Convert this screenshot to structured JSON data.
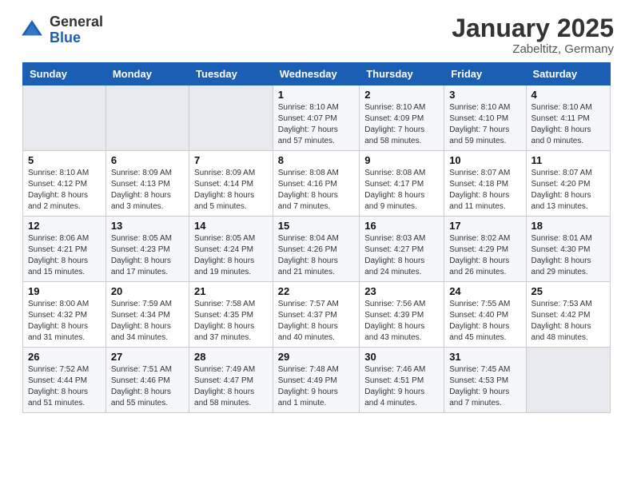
{
  "logo": {
    "general": "General",
    "blue": "Blue"
  },
  "title": "January 2025",
  "location": "Zabeltitz, Germany",
  "days_header": [
    "Sunday",
    "Monday",
    "Tuesday",
    "Wednesday",
    "Thursday",
    "Friday",
    "Saturday"
  ],
  "weeks": [
    [
      {
        "num": "",
        "info": ""
      },
      {
        "num": "",
        "info": ""
      },
      {
        "num": "",
        "info": ""
      },
      {
        "num": "1",
        "info": "Sunrise: 8:10 AM\nSunset: 4:07 PM\nDaylight: 7 hours\nand 57 minutes."
      },
      {
        "num": "2",
        "info": "Sunrise: 8:10 AM\nSunset: 4:09 PM\nDaylight: 7 hours\nand 58 minutes."
      },
      {
        "num": "3",
        "info": "Sunrise: 8:10 AM\nSunset: 4:10 PM\nDaylight: 7 hours\nand 59 minutes."
      },
      {
        "num": "4",
        "info": "Sunrise: 8:10 AM\nSunset: 4:11 PM\nDaylight: 8 hours\nand 0 minutes."
      }
    ],
    [
      {
        "num": "5",
        "info": "Sunrise: 8:10 AM\nSunset: 4:12 PM\nDaylight: 8 hours\nand 2 minutes."
      },
      {
        "num": "6",
        "info": "Sunrise: 8:09 AM\nSunset: 4:13 PM\nDaylight: 8 hours\nand 3 minutes."
      },
      {
        "num": "7",
        "info": "Sunrise: 8:09 AM\nSunset: 4:14 PM\nDaylight: 8 hours\nand 5 minutes."
      },
      {
        "num": "8",
        "info": "Sunrise: 8:08 AM\nSunset: 4:16 PM\nDaylight: 8 hours\nand 7 minutes."
      },
      {
        "num": "9",
        "info": "Sunrise: 8:08 AM\nSunset: 4:17 PM\nDaylight: 8 hours\nand 9 minutes."
      },
      {
        "num": "10",
        "info": "Sunrise: 8:07 AM\nSunset: 4:18 PM\nDaylight: 8 hours\nand 11 minutes."
      },
      {
        "num": "11",
        "info": "Sunrise: 8:07 AM\nSunset: 4:20 PM\nDaylight: 8 hours\nand 13 minutes."
      }
    ],
    [
      {
        "num": "12",
        "info": "Sunrise: 8:06 AM\nSunset: 4:21 PM\nDaylight: 8 hours\nand 15 minutes."
      },
      {
        "num": "13",
        "info": "Sunrise: 8:05 AM\nSunset: 4:23 PM\nDaylight: 8 hours\nand 17 minutes."
      },
      {
        "num": "14",
        "info": "Sunrise: 8:05 AM\nSunset: 4:24 PM\nDaylight: 8 hours\nand 19 minutes."
      },
      {
        "num": "15",
        "info": "Sunrise: 8:04 AM\nSunset: 4:26 PM\nDaylight: 8 hours\nand 21 minutes."
      },
      {
        "num": "16",
        "info": "Sunrise: 8:03 AM\nSunset: 4:27 PM\nDaylight: 8 hours\nand 24 minutes."
      },
      {
        "num": "17",
        "info": "Sunrise: 8:02 AM\nSunset: 4:29 PM\nDaylight: 8 hours\nand 26 minutes."
      },
      {
        "num": "18",
        "info": "Sunrise: 8:01 AM\nSunset: 4:30 PM\nDaylight: 8 hours\nand 29 minutes."
      }
    ],
    [
      {
        "num": "19",
        "info": "Sunrise: 8:00 AM\nSunset: 4:32 PM\nDaylight: 8 hours\nand 31 minutes."
      },
      {
        "num": "20",
        "info": "Sunrise: 7:59 AM\nSunset: 4:34 PM\nDaylight: 8 hours\nand 34 minutes."
      },
      {
        "num": "21",
        "info": "Sunrise: 7:58 AM\nSunset: 4:35 PM\nDaylight: 8 hours\nand 37 minutes."
      },
      {
        "num": "22",
        "info": "Sunrise: 7:57 AM\nSunset: 4:37 PM\nDaylight: 8 hours\nand 40 minutes."
      },
      {
        "num": "23",
        "info": "Sunrise: 7:56 AM\nSunset: 4:39 PM\nDaylight: 8 hours\nand 43 minutes."
      },
      {
        "num": "24",
        "info": "Sunrise: 7:55 AM\nSunset: 4:40 PM\nDaylight: 8 hours\nand 45 minutes."
      },
      {
        "num": "25",
        "info": "Sunrise: 7:53 AM\nSunset: 4:42 PM\nDaylight: 8 hours\nand 48 minutes."
      }
    ],
    [
      {
        "num": "26",
        "info": "Sunrise: 7:52 AM\nSunset: 4:44 PM\nDaylight: 8 hours\nand 51 minutes."
      },
      {
        "num": "27",
        "info": "Sunrise: 7:51 AM\nSunset: 4:46 PM\nDaylight: 8 hours\nand 55 minutes."
      },
      {
        "num": "28",
        "info": "Sunrise: 7:49 AM\nSunset: 4:47 PM\nDaylight: 8 hours\nand 58 minutes."
      },
      {
        "num": "29",
        "info": "Sunrise: 7:48 AM\nSunset: 4:49 PM\nDaylight: 9 hours\nand 1 minute."
      },
      {
        "num": "30",
        "info": "Sunrise: 7:46 AM\nSunset: 4:51 PM\nDaylight: 9 hours\nand 4 minutes."
      },
      {
        "num": "31",
        "info": "Sunrise: 7:45 AM\nSunset: 4:53 PM\nDaylight: 9 hours\nand 7 minutes."
      },
      {
        "num": "",
        "info": ""
      }
    ]
  ]
}
